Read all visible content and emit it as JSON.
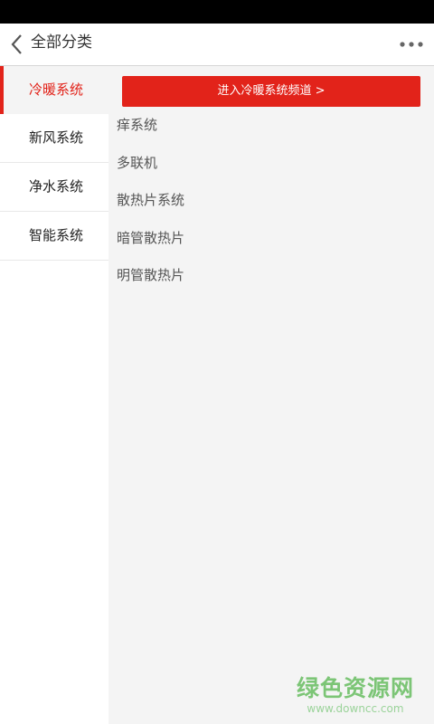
{
  "header": {
    "title": "全部分类",
    "back_icon": "chevron-left-icon",
    "more_icon": "more-dots-icon"
  },
  "sidebar": {
    "items": [
      {
        "label": "冷暖系统",
        "active": true
      },
      {
        "label": "新风系统",
        "active": false
      },
      {
        "label": "净水系统",
        "active": false
      },
      {
        "label": "智能系统",
        "active": false
      }
    ]
  },
  "content": {
    "channel_button": "进入冷暖系统频道 >",
    "subcategories": [
      "痒系统",
      "多联机",
      "散热片系统",
      "暗管散热片",
      "明管散热片"
    ]
  },
  "watermark": {
    "main": "绿色资源网",
    "sub": "www.downcc.com"
  },
  "colors": {
    "accent": "#e2231a",
    "content_bg": "#f4f4f4",
    "watermark": "#7cc576"
  }
}
